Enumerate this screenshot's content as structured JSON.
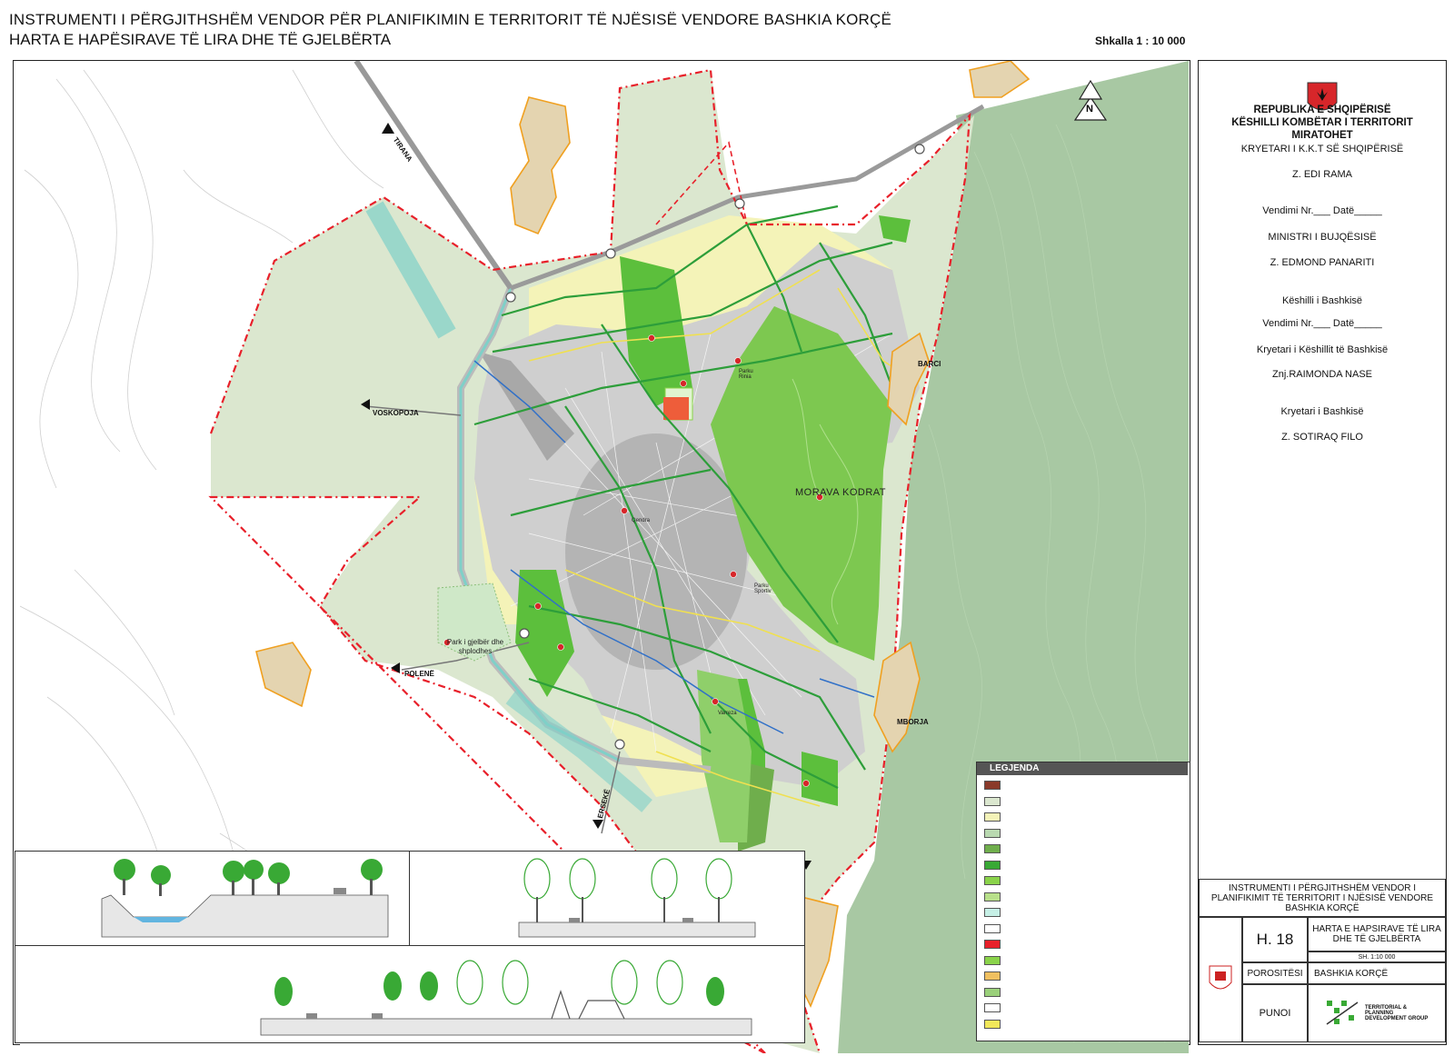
{
  "header": {
    "title_line1": "INSTRUMENTI I PËRGJITHSHËM VENDOR PËR PLANIFIKIMIN E TERRITORIT TË NJËSISË VENDORE BASHKIA KORÇË",
    "title_line2": "HARTA E HAPËSIRAVE TË LIRA DHE TË GJELBËRTA",
    "scale": "Shkalla 1 : 10 000"
  },
  "colors": {
    "boundary": "#e8202a",
    "green_dark": "#39a935",
    "green_light": "#8ad34a",
    "yellow_zone": "#f4f3b8",
    "pale_green": "#dbe7cf",
    "mountain": "#9ec299",
    "village": "#e4d4b0",
    "village_border": "#f0a020",
    "canal": "#7fd0c8"
  },
  "approval_panel": {
    "republic": "REPUBLIKA E SHQIPËRISË",
    "council": "KËSHILLI KOMBËTAR I TERRITORIT",
    "approved": "MIRATOHET",
    "chair": "KRYETARI I K.K.T SË SHQIPËRISË",
    "chair_name": "Z. EDI RAMA",
    "decision1": "Vendimi Nr.___ Datë_____",
    "minister": "MINISTRI I BUJQËSISË",
    "minister_name": "Z. EDMOND PANARITI",
    "municipal_council": "Këshilli i Bashkisë",
    "decision2": "Vendimi Nr.___ Datë_____",
    "council_chair": "Kryetari i Këshillit të Bashkisë",
    "council_chair_name": "Znj.RAIMONDA NASE",
    "mayor": "Kryetari i Bashkisë",
    "mayor_name": "Z. SOTIRAQ FILO",
    "north_label": "N"
  },
  "title_block": {
    "project_title": "INSTRUMENTI I PËRGJITHSHËM VENDOR I PLANIFIKIMIT TË TERRITORIT I NJËSISË VENDORE BASHKIA KORÇË",
    "sheet_no": "H. 18",
    "sheet_title": "HARTA E HAPSIRAVE TË LIRA DHE TË GJELBËRTA",
    "sheet_scale": "SH. 1:10 000",
    "client_label": "POROSITËSI",
    "client": "BASHKIA KORÇË",
    "author_label": "PUNOI",
    "author_logo": "TERRITORIAL & PLANNING DEVELOPMENT GROUP"
  },
  "legend": {
    "title": "LEGJENDA",
    "rows": [
      {
        "color": "#8a3a2a",
        "text": ""
      },
      {
        "color": "#dbe7cf",
        "text": ""
      },
      {
        "color": "#f4f3b8",
        "text": ""
      },
      {
        "color": "#b9d9b0",
        "text": ""
      },
      {
        "color": "#6fae4c",
        "text": ""
      },
      {
        "color": "#39a935",
        "text": ""
      },
      {
        "color": "#8ad34a",
        "text": ""
      },
      {
        "color": "#b8e08a",
        "text": ""
      },
      {
        "color": "#c6f0e6",
        "text": ""
      },
      {
        "color": "#ffffff",
        "text": ""
      },
      {
        "color": "#e8202a",
        "text": ""
      },
      {
        "color": "#8ad34a",
        "text": ""
      },
      {
        "color": "#f0c060",
        "text": ""
      },
      {
        "color": "#9ad07a",
        "text": ""
      },
      {
        "color": "#ffffff",
        "text": ""
      },
      {
        "color": "#f2e85a",
        "text": ""
      }
    ]
  },
  "map_labels": {
    "tirana": "TIRANA",
    "voskopoja": "VOSKOPOJA",
    "polene": "POLENË",
    "erseke": "ERSEKË",
    "barci": "BARCI",
    "mborja": "MBORJA",
    "morava": "MORAVA KODRAT",
    "park_gjelber": "Park i gjelbër dhe shplodhes",
    "varreza": "Varreza",
    "park_rinia": "Parku Rinia",
    "park_sport": "Parku Sportiv",
    "qendra": "Qendra"
  }
}
